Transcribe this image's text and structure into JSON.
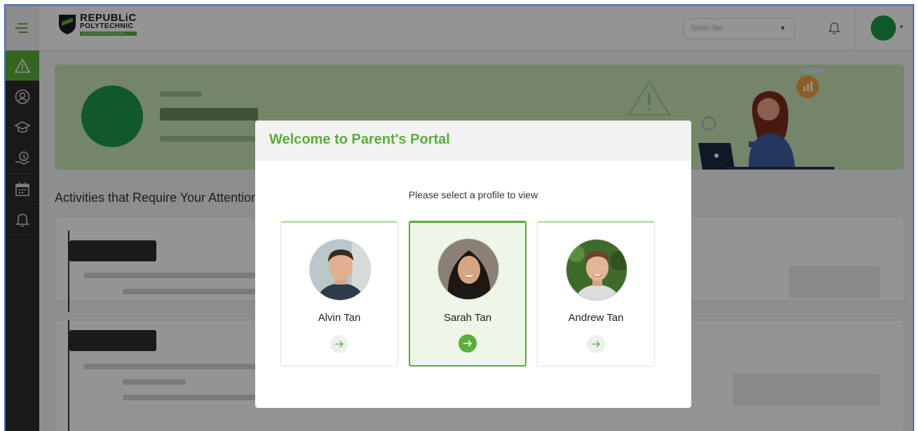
{
  "header": {
    "logo_line1": "REPUBLiC",
    "logo_line2": "POLYTECHNIC",
    "logo_tagline": "GOLDEN TOMORROW SCHOOL",
    "profile_select_value": "Sarah Tan"
  },
  "sidebar": {
    "items": [
      {
        "icon": "alert-triangle-icon",
        "active": true
      },
      {
        "icon": "user-circle-icon",
        "active": false
      },
      {
        "icon": "graduation-cap-icon",
        "active": false
      },
      {
        "icon": "money-hand-icon",
        "active": false
      },
      {
        "icon": "calendar-icon",
        "active": false
      },
      {
        "icon": "bell-icon",
        "active": false
      }
    ]
  },
  "background": {
    "section_title": "Activities that Require Your Attention"
  },
  "modal": {
    "title": "Welcome to Parent's Portal",
    "subtitle": "Please select a profile to view",
    "profiles": [
      {
        "name": "Alvin Tan",
        "selected": false
      },
      {
        "name": "Sarah Tan",
        "selected": true
      },
      {
        "name": "Andrew Tan",
        "selected": false
      }
    ]
  },
  "colors": {
    "accent": "#5aae3a",
    "sidebar": "#2b2b2b",
    "banner": "#c9e6b5",
    "frame_border": "#3d6fb8"
  }
}
